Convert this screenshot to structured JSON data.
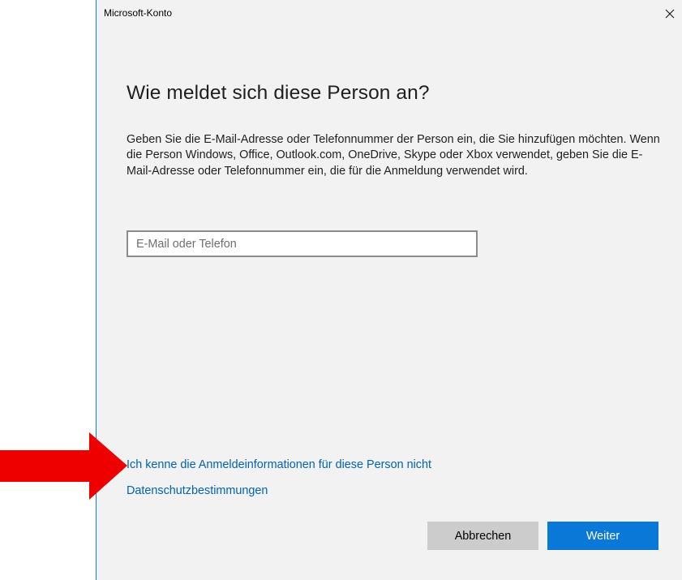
{
  "window": {
    "title": "Microsoft-Konto"
  },
  "content": {
    "heading": "Wie meldet sich diese Person an?",
    "description": "Geben Sie die E-Mail-Adresse oder Telefonnummer der Person ein, die Sie hinzufügen möchten. Wenn die Person Windows, Office, Outlook.com, OneDrive, Skype oder Xbox verwendet, geben Sie die E-Mail-Adresse oder Telefonnummer ein, die für die Anmeldung verwendet wird.",
    "email_input": {
      "value": "",
      "placeholder": "E-Mail oder Telefon"
    }
  },
  "links": {
    "unknown_credentials": "Ich kenne die Anmeldeinformationen für diese Person nicht",
    "privacy": "Datenschutzbestimmungen"
  },
  "buttons": {
    "cancel": "Abbrechen",
    "next": "Weiter"
  },
  "icons": {
    "close": "close-icon",
    "annotation": "red-arrow-icon"
  },
  "colors": {
    "accent": "#0a78d7",
    "link": "#0063b1",
    "dialog_background": "#f2f2f2",
    "annotation_arrow": "#ee0000"
  }
}
